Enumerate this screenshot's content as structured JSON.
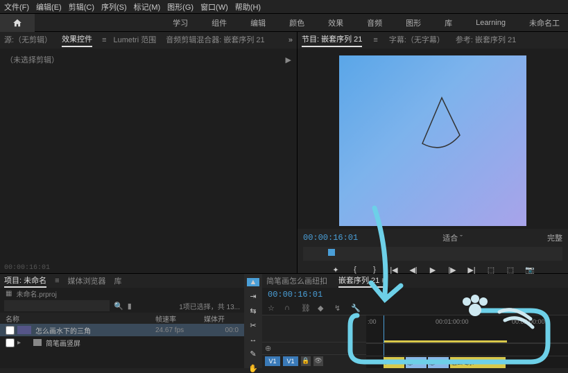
{
  "menu": [
    "文件(F)",
    "编辑(E)",
    "剪辑(C)",
    "序列(S)",
    "标记(M)",
    "图形(G)",
    "窗口(W)",
    "帮助(H)"
  ],
  "workspaces": [
    "学习",
    "组件",
    "编辑",
    "颜色",
    "效果",
    "音频",
    "图形",
    "库",
    "Learning",
    "未命名工"
  ],
  "left_tabs": {
    "source": "源:（无剪辑）",
    "effect_controls": "效果控件",
    "lumetri": "Lumetri 范围",
    "audio_mixer": "音频剪辑混合器: 嵌套序列 21"
  },
  "no_clip_text": "（未选择剪辑）",
  "left_tc": "00:00:16:01",
  "program_tabs": {
    "program": "节目: 嵌套序列 21",
    "caption": "字幕:（无字幕）",
    "reference": "参考: 嵌套序列 21"
  },
  "program_timecode": "00:00:16:01",
  "fit_label": "适合",
  "full_label": "完整",
  "project_tabs": {
    "project": "项目: 未命名",
    "media_browser": "媒体浏览器",
    "library": "库"
  },
  "project_name": "未命名.prproj",
  "search_status": "1项已选择，共 13...",
  "columns": {
    "name": "名称",
    "framerate": "帧速率",
    "media_start": "媒体开"
  },
  "rows": [
    {
      "name": "怎么画水下的三角",
      "fr": "24.67 fps",
      "ms": "00:0"
    },
    {
      "name": "简笔画竖屏",
      "fr": "",
      "ms": ""
    }
  ],
  "timeline_tabs": {
    "seq1": "简笔画怎么画纽扣",
    "seq2": "嵌套序列 21"
  },
  "timeline_tc": "00:00:16:01",
  "ruler_ticks": [
    {
      "label": ":00",
      "pos": 2
    },
    {
      "label": "00:01:00:00",
      "pos": 100
    },
    {
      "label": "00:02:00:00",
      "pos": 210
    }
  ],
  "v1": "V1",
  "clip_labels": [
    "f",
    "忘",
    "忘",
    "怎么喝水"
  ],
  "icons": {
    "home": "⌂",
    "menu": "≡",
    "play_arrow": "▶"
  }
}
